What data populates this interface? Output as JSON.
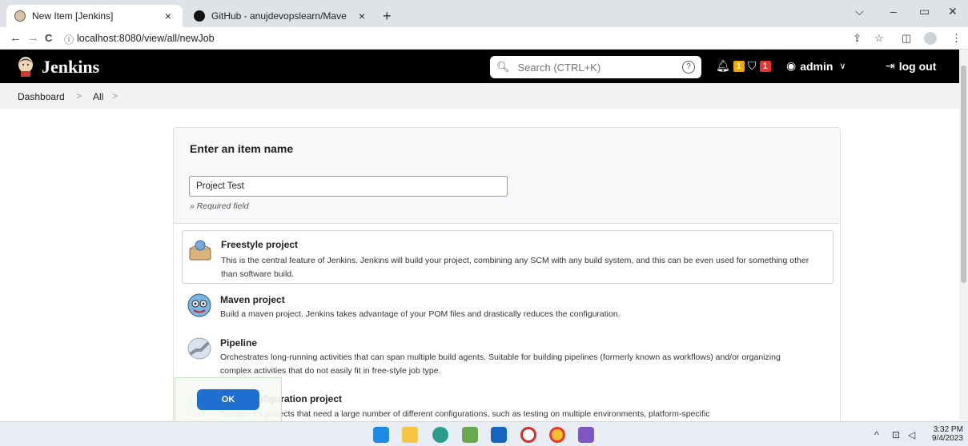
{
  "browser": {
    "tabs": [
      {
        "title": "New Item [Jenkins]",
        "close": "×"
      },
      {
        "title": "GitHub - anujdevopslearn/Mave",
        "close": "×"
      }
    ],
    "new_tab": "+",
    "window_controls": {
      "dropdown": "⌵",
      "minimize": "–",
      "restore": "▭",
      "close": "✕"
    },
    "nav": {
      "back": "←",
      "forward": "→",
      "reload": "C"
    },
    "url": "localhost:8080/view/all/newJob",
    "url_info_icon": "ⓘ"
  },
  "header": {
    "brand": "Jenkins",
    "search_placeholder": "Search (CTRL+K)",
    "help": "?",
    "notifications_count": "1",
    "security_count": "1",
    "user": "admin",
    "logout": "log out"
  },
  "breadcrumb": {
    "items": [
      "Dashboard",
      "All"
    ],
    "separator": ">"
  },
  "form": {
    "title": "Enter an item name",
    "item_name_value": "Project Test",
    "required_hint": "» Required field"
  },
  "items": [
    {
      "title": "Freestyle project",
      "desc": "This is the central feature of Jenkins. Jenkins will build your project, combining any SCM with any build system, and this can be even used for something other than software build.",
      "icon": "freestyle-icon",
      "selected": true
    },
    {
      "title": "Maven project",
      "desc": "Build a maven project. Jenkins takes advantage of your POM files and drastically reduces the configuration.",
      "icon": "maven-icon",
      "selected": false
    },
    {
      "title": "Pipeline",
      "desc": "Orchestrates long-running activities that can span multiple build agents. Suitable for building pipelines (formerly known as workflows) and/or organizing complex activities that do not easily fit in free-style job type.",
      "icon": "pipeline-icon",
      "selected": false
    },
    {
      "title": "Multi-configuration project",
      "desc": "Suitable for projects that need a large number of different configurations, such as testing on multiple environments, platform-specific",
      "icon": "multiconfig-icon",
      "selected": false
    }
  ],
  "ok_button": "OK",
  "taskbar": {
    "time": "3:32 PM",
    "date": "9/4/2023",
    "tray_chevron": "^"
  },
  "colors": {
    "header_bg": "#000000",
    "badge_orange": "#f5a700",
    "badge_red": "#e3342f",
    "ok_blue": "#1f6fd1"
  }
}
